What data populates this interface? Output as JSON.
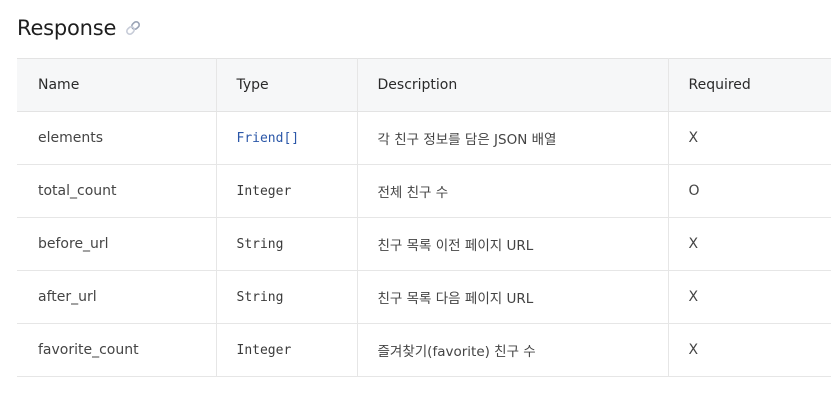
{
  "section": {
    "title": "Response",
    "icon": "link-icon"
  },
  "table": {
    "headers": {
      "name": "Name",
      "type": "Type",
      "description": "Description",
      "required": "Required"
    },
    "rows": [
      {
        "name": "elements",
        "type": "Friend[]",
        "type_is_link": true,
        "description": "각 친구 정보를 담은 JSON 배열",
        "required": "X"
      },
      {
        "name": "total_count",
        "type": "Integer",
        "type_is_link": false,
        "description": "전체 친구 수",
        "required": "O"
      },
      {
        "name": "before_url",
        "type": "String",
        "type_is_link": false,
        "description": "친구 목록 이전 페이지 URL",
        "required": "X"
      },
      {
        "name": "after_url",
        "type": "String",
        "type_is_link": false,
        "description": "친구 목록 다음 페이지 URL",
        "required": "X"
      },
      {
        "name": "favorite_count",
        "type": "Integer",
        "type_is_link": false,
        "description": "즐겨찾기(favorite) 친구 수",
        "required": "X"
      }
    ]
  },
  "colors": {
    "header_bg": "#f6f7f8",
    "link": "#2b57a8",
    "border": "#e6e6e6"
  }
}
